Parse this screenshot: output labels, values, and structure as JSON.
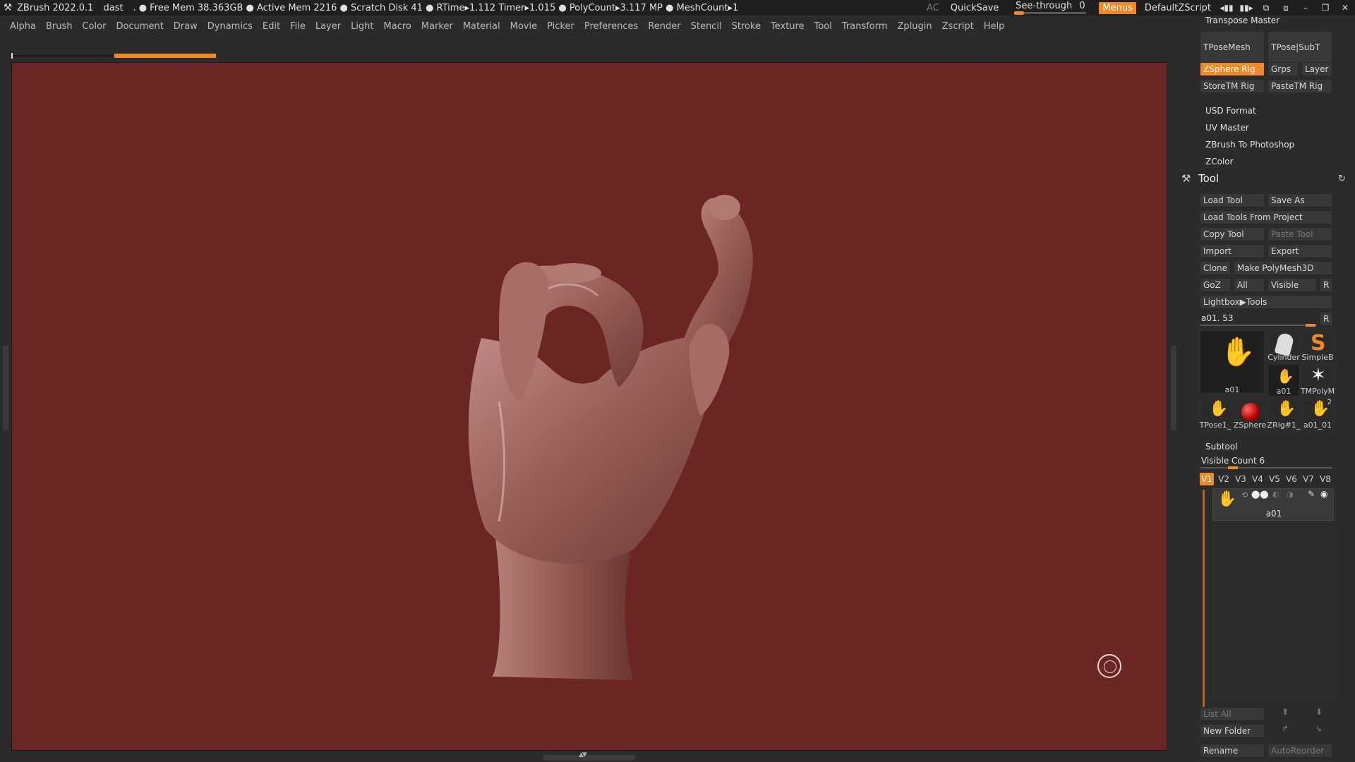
{
  "titlebar": {
    "app": "ZBrush 2022.0.1",
    "user": "dast",
    "dot": ".",
    "stats": "● Free Mem 38.363GB ● Active Mem 2216 ● Scratch Disk 41 ● RTime▸1.112 Timer▸1.015 ● PolyCount▸3.117 MP ● MeshCount▸1",
    "ac": "AC",
    "quicksave": "QuickSave",
    "seethrough": "See-through",
    "seethrough_value": "0",
    "seethrough_level": 0,
    "menus": "Menus",
    "default_zscript": "DefaultZScript"
  },
  "menubar": [
    "Alpha",
    "Brush",
    "Color",
    "Document",
    "Draw",
    "Dynamics",
    "Edit",
    "File",
    "Layer",
    "Light",
    "Macro",
    "Marker",
    "Material",
    "Movie",
    "Picker",
    "Preferences",
    "Render",
    "Stencil",
    "Stroke",
    "Texture",
    "Tool",
    "Transform",
    "Zplugin",
    "Zscript",
    "Help"
  ],
  "panel": {
    "transpose_master": "Transpose Master",
    "tpose_mesh": "TPoseMesh",
    "tpose_subt": "TPose|SubT",
    "zsphere_rig": "ZSphere Rig",
    "grps": "Grps",
    "layer": "Layer",
    "store_tm_rig": "StoreTM Rig",
    "paste_tm_rig": "PasteTM Rig",
    "plugins": [
      "USD Format",
      "UV Master",
      "ZBrush To Photoshop",
      "ZColor"
    ],
    "tool_title": "Tool",
    "load_tool": "Load Tool",
    "save_as": "Save As",
    "load_tools_from_project": "Load Tools From Project",
    "copy_tool": "Copy Tool",
    "paste_tool": "Paste Tool",
    "import": "Import",
    "export": "Export",
    "clone": "Clone",
    "make_polymesh": "Make PolyMesh3D",
    "goz": "GoZ",
    "all": "All",
    "visible": "Visible",
    "r": "R",
    "lightbox_tools": "Lightbox▶Tools",
    "current_tool": "a01. 53",
    "thumbs": [
      "a01",
      "Cylinder",
      "SimpleB",
      "a01",
      "TMPolyM",
      "TPose1_",
      "ZSphere",
      "ZRig#1_",
      "a01_01"
    ],
    "thumb_badge": "2",
    "subtool": "Subtool",
    "visible_count": "Visible Count 6",
    "vtabs": [
      "V1",
      "V2",
      "V3",
      "V4",
      "V5",
      "V6",
      "V7",
      "V8"
    ],
    "subtool_item": "a01",
    "list_all": "List All",
    "new_folder": "New Folder",
    "rename": "Rename",
    "autoreorder": "AutoReorder"
  },
  "colors": {
    "accent": "#f08a24",
    "canvas_bg": "#6b2524",
    "skin": "#9a5f5a"
  }
}
